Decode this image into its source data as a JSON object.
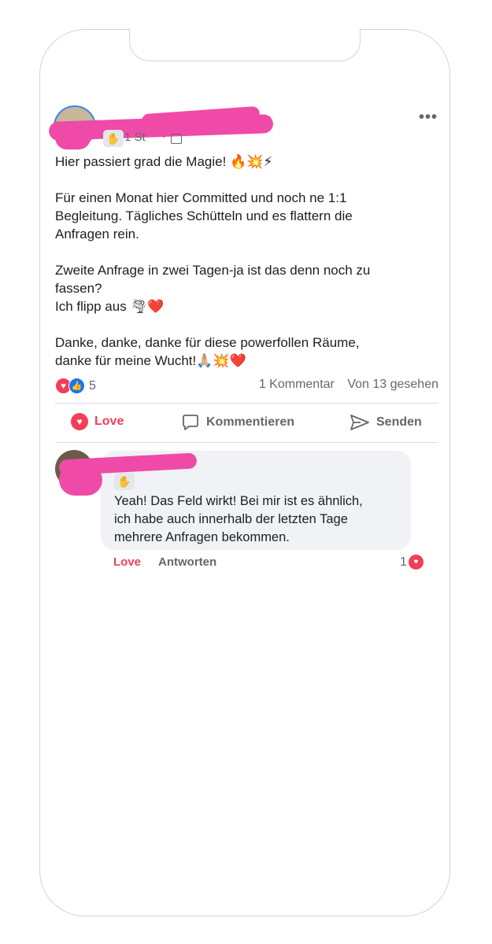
{
  "post": {
    "time_label": "1 St",
    "time_dot": "·",
    "paragraphs": [
      "Hier passiert grad die Magie! 🔥💥⚡",
      "Für einen Monat hier Committed und noch ne 1:1\nBegleitung. Tägliches Schütteln und es flattern die\nAnfragen rein.",
      "Zweite Anfrage in zwei Tagen-ja ist das denn noch zu\nfassen?\nIch flipp aus 🌪❤️",
      "Danke, danke, danke für diese powerfollen Räume,\ndanke für meine Wucht!🙏🏼💥❤️"
    ],
    "reaction_count": "5",
    "comments_count": "1 Kommentar",
    "views": "Von 13 gesehen"
  },
  "actions": {
    "love": "Love",
    "comment": "Kommentieren",
    "send": "Senden"
  },
  "comment": {
    "text": "Yeah! Das Feld wirkt! Bei mir ist es ähnlich,\nich habe auch innerhalb der letzten Tage\nmehrere Anfragen bekommen.",
    "love_label": "Love",
    "reply_label": "Antworten",
    "love_count": "1"
  },
  "icons": {
    "hand_badge": "✋",
    "more": "•••"
  },
  "colors": {
    "love": "#f33e58",
    "like": "#1877f2",
    "redaction": "#f04aa8",
    "muted_text": "#65676b"
  }
}
